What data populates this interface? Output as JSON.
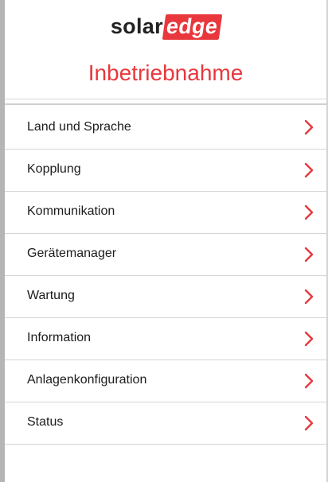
{
  "header": {
    "logo_solar": "solar",
    "logo_edge": "edge",
    "title": "Inbetriebnahme"
  },
  "colors": {
    "accent": "#e8383d",
    "text": "#1c1c1c",
    "divider": "#d4d4d4"
  },
  "menu": {
    "items": [
      {
        "label": "Land und Sprache",
        "icon": "chevron-right-icon"
      },
      {
        "label": "Kopplung",
        "icon": "chevron-right-icon"
      },
      {
        "label": "Kommunikation",
        "icon": "chevron-right-icon"
      },
      {
        "label": "Gerätemanager",
        "icon": "chevron-right-icon"
      },
      {
        "label": "Wartung",
        "icon": "chevron-right-icon"
      },
      {
        "label": "Information",
        "icon": "chevron-right-icon"
      },
      {
        "label": "Anlagenkonfiguration",
        "icon": "chevron-right-icon"
      },
      {
        "label": "Status",
        "icon": "chevron-right-icon"
      }
    ]
  }
}
